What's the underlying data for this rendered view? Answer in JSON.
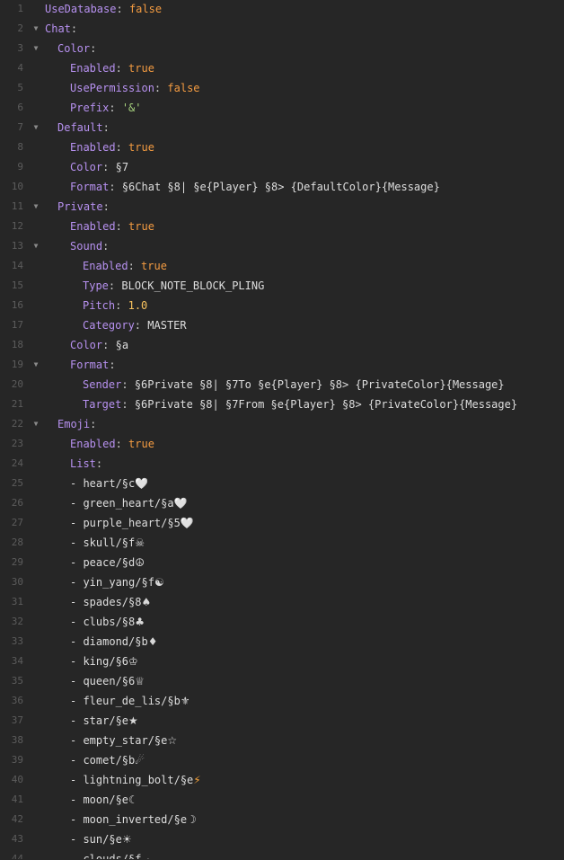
{
  "editor": {
    "lines": [
      {
        "n": "1",
        "fold": false,
        "indent": 0,
        "key": "UseDatabase",
        "value": "false",
        "vtype": "bool"
      },
      {
        "n": "2",
        "fold": true,
        "indent": 0,
        "key": "Chat",
        "value": "",
        "vtype": "none"
      },
      {
        "n": "3",
        "fold": true,
        "indent": 1,
        "key": "Color",
        "value": "",
        "vtype": "none"
      },
      {
        "n": "4",
        "fold": false,
        "indent": 2,
        "key": "Enabled",
        "value": "true",
        "vtype": "bool"
      },
      {
        "n": "5",
        "fold": false,
        "indent": 2,
        "key": "UsePermission",
        "value": "false",
        "vtype": "bool"
      },
      {
        "n": "6",
        "fold": false,
        "indent": 2,
        "key": "Prefix",
        "value": "'&'",
        "vtype": "str"
      },
      {
        "n": "7",
        "fold": true,
        "indent": 1,
        "key": "Default",
        "value": "",
        "vtype": "none"
      },
      {
        "n": "8",
        "fold": false,
        "indent": 2,
        "key": "Enabled",
        "value": "true",
        "vtype": "bool"
      },
      {
        "n": "9",
        "fold": false,
        "indent": 2,
        "key": "Color",
        "value": "§7",
        "vtype": "plain"
      },
      {
        "n": "10",
        "fold": false,
        "indent": 2,
        "key": "Format",
        "value": "§6Chat §8| §e{Player} §8> {DefaultColor}{Message}",
        "vtype": "plain"
      },
      {
        "n": "11",
        "fold": true,
        "indent": 1,
        "key": "Private",
        "value": "",
        "vtype": "none"
      },
      {
        "n": "12",
        "fold": false,
        "indent": 2,
        "key": "Enabled",
        "value": "true",
        "vtype": "bool"
      },
      {
        "n": "13",
        "fold": true,
        "indent": 2,
        "key": "Sound",
        "value": "",
        "vtype": "none"
      },
      {
        "n": "14",
        "fold": false,
        "indent": 3,
        "key": "Enabled",
        "value": "true",
        "vtype": "bool"
      },
      {
        "n": "15",
        "fold": false,
        "indent": 3,
        "key": "Type",
        "value": "BLOCK_NOTE_BLOCK_PLING",
        "vtype": "plain"
      },
      {
        "n": "16",
        "fold": false,
        "indent": 3,
        "key": "Pitch",
        "value": "1.0",
        "vtype": "num"
      },
      {
        "n": "17",
        "fold": false,
        "indent": 3,
        "key": "Category",
        "value": "MASTER",
        "vtype": "plain"
      },
      {
        "n": "18",
        "fold": false,
        "indent": 2,
        "key": "Color",
        "value": "§a",
        "vtype": "plain"
      },
      {
        "n": "19",
        "fold": true,
        "indent": 2,
        "key": "Format",
        "value": "",
        "vtype": "none"
      },
      {
        "n": "20",
        "fold": false,
        "indent": 3,
        "key": "Sender",
        "value": "§6Private §8| §7To §e{Player} §8> {PrivateColor}{Message}",
        "vtype": "plain"
      },
      {
        "n": "21",
        "fold": false,
        "indent": 3,
        "key": "Target",
        "value": "§6Private §8| §7From §e{Player} §8> {PrivateColor}{Message}",
        "vtype": "plain"
      },
      {
        "n": "22",
        "fold": true,
        "indent": 1,
        "key": "Emoji",
        "value": "",
        "vtype": "none"
      },
      {
        "n": "23",
        "fold": false,
        "indent": 2,
        "key": "Enabled",
        "value": "true",
        "vtype": "bool"
      },
      {
        "n": "24",
        "fold": false,
        "indent": 2,
        "key": "List",
        "value": "",
        "vtype": "none"
      },
      {
        "n": "25",
        "fold": false,
        "indent": 2,
        "item": "heart/§c",
        "emoji": "🤍",
        "emoji_style": "heart"
      },
      {
        "n": "26",
        "fold": false,
        "indent": 2,
        "item": "green_heart/§a",
        "emoji": "🤍",
        "emoji_style": "heart"
      },
      {
        "n": "27",
        "fold": false,
        "indent": 2,
        "item": "purple_heart/§5",
        "emoji": "🤍",
        "emoji_style": "heart"
      },
      {
        "n": "28",
        "fold": false,
        "indent": 2,
        "item": "skull/§f",
        "emoji": "☠",
        "emoji_style": "plain"
      },
      {
        "n": "29",
        "fold": false,
        "indent": 2,
        "item": "peace/§d",
        "emoji": "☮",
        "emoji_style": "plain"
      },
      {
        "n": "30",
        "fold": false,
        "indent": 2,
        "item": "yin_yang/§f",
        "emoji": "☯",
        "emoji_style": "plain"
      },
      {
        "n": "31",
        "fold": false,
        "indent": 2,
        "item": "spades/§8",
        "emoji": "♠",
        "emoji_style": "plain"
      },
      {
        "n": "32",
        "fold": false,
        "indent": 2,
        "item": "clubs/§8",
        "emoji": "♣",
        "emoji_style": "plain"
      },
      {
        "n": "33",
        "fold": false,
        "indent": 2,
        "item": "diamond/§b",
        "emoji": "♦",
        "emoji_style": "plain"
      },
      {
        "n": "34",
        "fold": false,
        "indent": 2,
        "item": "king/§6",
        "emoji": "♔",
        "emoji_style": "plain"
      },
      {
        "n": "35",
        "fold": false,
        "indent": 2,
        "item": "queen/§6",
        "emoji": "♕",
        "emoji_style": "plain"
      },
      {
        "n": "36",
        "fold": false,
        "indent": 2,
        "item": "fleur_de_lis/§b",
        "emoji": "⚜",
        "emoji_style": "plain"
      },
      {
        "n": "37",
        "fold": false,
        "indent": 2,
        "item": "star/§e",
        "emoji": "★",
        "emoji_style": "plain"
      },
      {
        "n": "38",
        "fold": false,
        "indent": 2,
        "item": "empty_star/§e",
        "emoji": "☆",
        "emoji_style": "plain"
      },
      {
        "n": "39",
        "fold": false,
        "indent": 2,
        "item": "comet/§b",
        "emoji": "☄",
        "emoji_style": "plain"
      },
      {
        "n": "40",
        "fold": false,
        "indent": 2,
        "item": "lightning_bolt/§e",
        "emoji": "⚡",
        "emoji_style": "bolt"
      },
      {
        "n": "41",
        "fold": false,
        "indent": 2,
        "item": "moon/§e",
        "emoji": "☾",
        "emoji_style": "plain"
      },
      {
        "n": "42",
        "fold": false,
        "indent": 2,
        "item": "moon_inverted/§e",
        "emoji": "☽",
        "emoji_style": "plain"
      },
      {
        "n": "43",
        "fold": false,
        "indent": 2,
        "item": "sun/§e",
        "emoji": "☀",
        "emoji_style": "plain"
      },
      {
        "n": "44",
        "fold": false,
        "indent": 2,
        "item": "clouds/§f",
        "emoji": "☁",
        "emoji_style": "plain"
      }
    ]
  },
  "colors": {
    "background": "#262626",
    "key": "#b791f0",
    "boolean": "#f39b41",
    "number": "#f7c25e",
    "string": "#a7d37e",
    "plain": "#dedede",
    "line_number": "#5c5c5c"
  },
  "icons": {
    "fold": "fold-arrow-icon"
  }
}
